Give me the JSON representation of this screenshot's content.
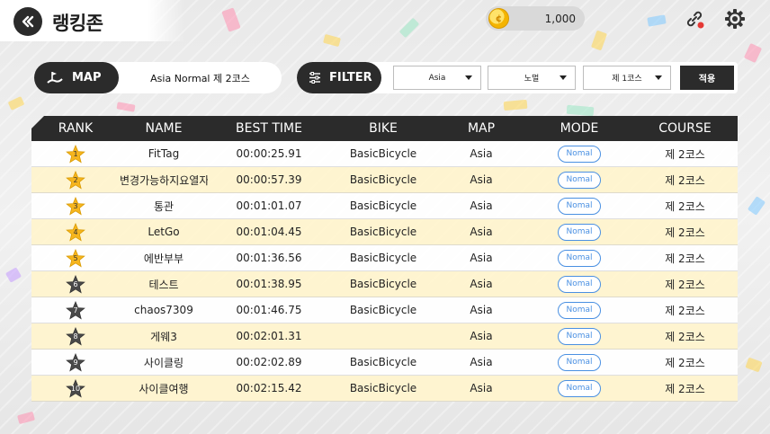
{
  "header": {
    "title": "랭킹존",
    "coins": "1,000"
  },
  "map_filter": {
    "label": "MAP",
    "value": "Asia Normal 제 2코스"
  },
  "filter": {
    "label": "FILTER",
    "region": "Asia",
    "mode": "노멀",
    "course": "제 1코스",
    "apply_label": "적용"
  },
  "columns": [
    "RANK",
    "NAME",
    "BEST TIME",
    "BIKE",
    "MAP",
    "MODE",
    "COURSE"
  ],
  "rows": [
    {
      "rank": "1",
      "name": "FitTag",
      "time": "00:00:25.91",
      "bike": "BasicBicycle",
      "map": "Asia",
      "mode": "Nomal",
      "course": "제 2코스"
    },
    {
      "rank": "2",
      "name": "변경가능하지요열자리",
      "time": "00:00:57.39",
      "bike": "BasicBicycle",
      "map": "Asia",
      "mode": "Nomal",
      "course": "제 2코스"
    },
    {
      "rank": "3",
      "name": "통관",
      "time": "00:01:01.07",
      "bike": "BasicBicycle",
      "map": "Asia",
      "mode": "Nomal",
      "course": "제 2코스"
    },
    {
      "rank": "4",
      "name": "LetGo",
      "time": "00:01:04.45",
      "bike": "BasicBicycle",
      "map": "Asia",
      "mode": "Nomal",
      "course": "제 2코스"
    },
    {
      "rank": "5",
      "name": "에반부부",
      "time": "00:01:36.56",
      "bike": "BasicBicycle",
      "map": "Asia",
      "mode": "Nomal",
      "course": "제 2코스"
    },
    {
      "rank": "6",
      "name": "테스트",
      "time": "00:01:38.95",
      "bike": "BasicBicycle",
      "map": "Asia",
      "mode": "Nomal",
      "course": "제 2코스"
    },
    {
      "rank": "7",
      "name": "chaos7309",
      "time": "00:01:46.75",
      "bike": "BasicBicycle",
      "map": "Asia",
      "mode": "Nomal",
      "course": "제 2코스"
    },
    {
      "rank": "8",
      "name": "게웨3",
      "time": "00:02:01.31",
      "bike": "",
      "map": "Asia",
      "mode": "Nomal",
      "course": "제 2코스"
    },
    {
      "rank": "9",
      "name": "사이클링",
      "time": "00:02:02.89",
      "bike": "BasicBicycle",
      "map": "Asia",
      "mode": "Nomal",
      "course": "제 2코스"
    },
    {
      "rank": "10",
      "name": "사이클여행",
      "time": "00:02:15.42",
      "bike": "BasicBicycle",
      "map": "Asia",
      "mode": "Nomal",
      "course": "제 2코스"
    }
  ],
  "colors": {
    "dark": "#2b2b2b",
    "row_alt": "#fff4cd",
    "gold_star": "#f6b51e",
    "grey_star": "#4a4a4a",
    "mode_blue": "#4a90e2",
    "alert_dot": "#e53935"
  },
  "icons": {
    "back": "double-chevron-left-icon",
    "coin": "coin-icon",
    "link": "link-icon",
    "settings": "gear-icon",
    "map": "flag-icon",
    "filter": "sliders-icon"
  }
}
